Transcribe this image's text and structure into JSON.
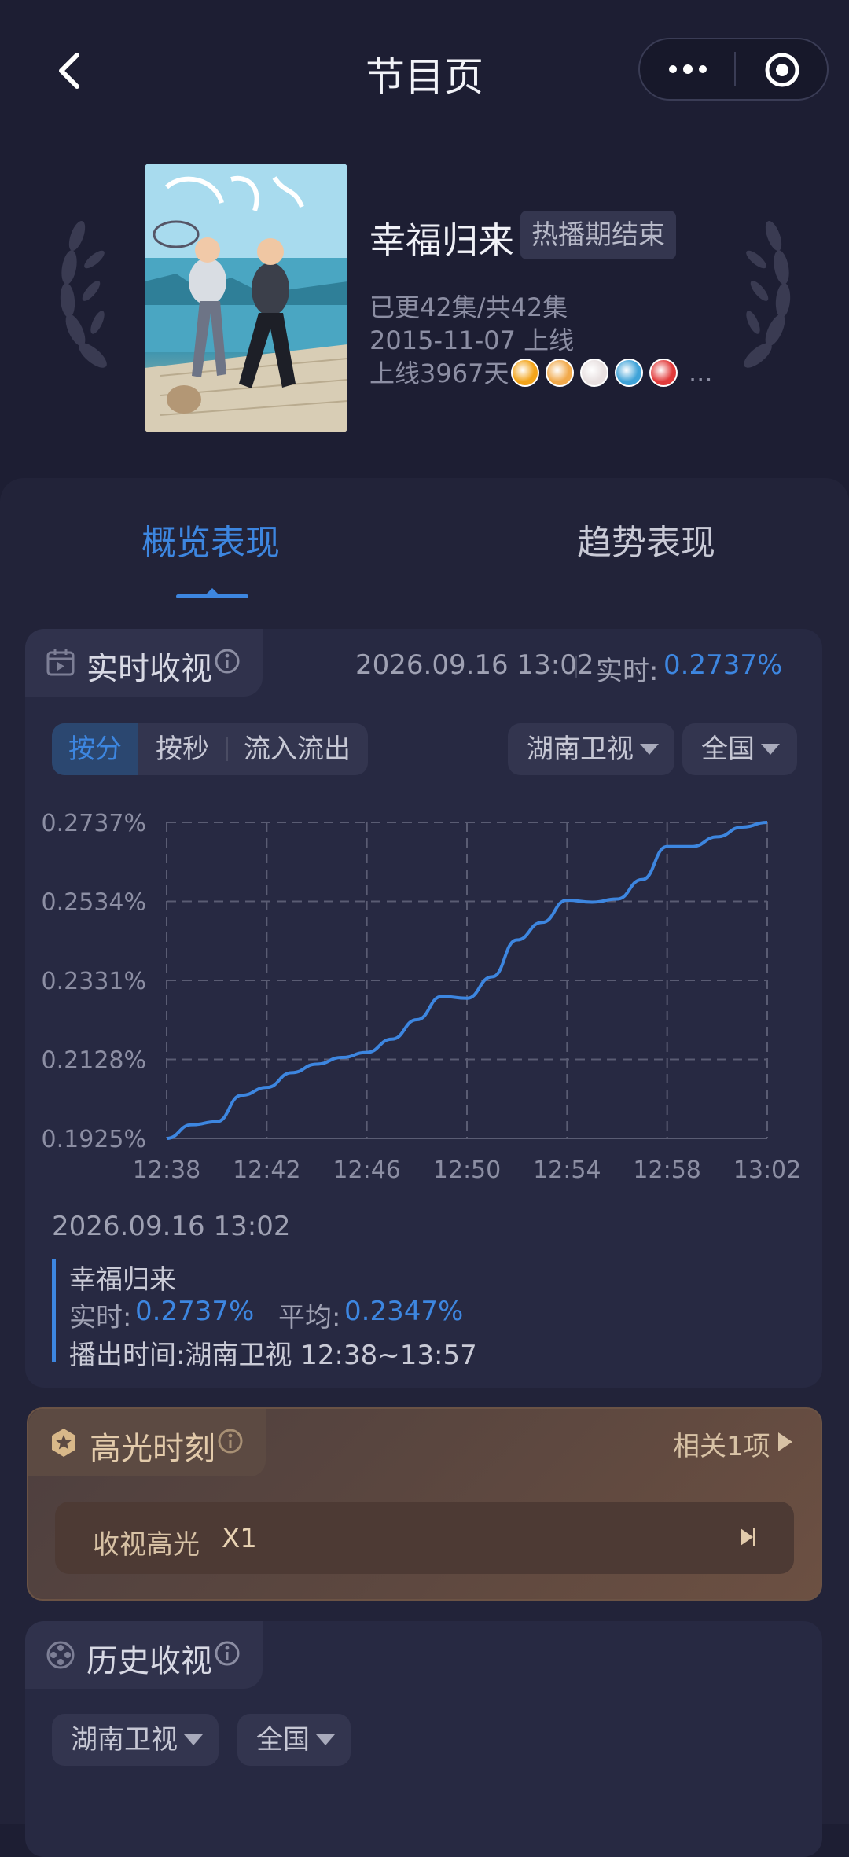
{
  "header": {
    "title": "节目页",
    "back_icon": "chevron-left-icon",
    "more_icon": "more-dots-icon",
    "target_icon": "target-circle-icon"
  },
  "show": {
    "title": "幸福归来",
    "status": "热播期结束",
    "episodes": "已更42集/共42集",
    "premiere": "2015-11-07 上线",
    "days_online": "上线3967天",
    "more": "...",
    "channel_logos": [
      "hunan-tv-logo",
      "shenzhen-tv-logo",
      "jiangsu-tv-logo",
      "zhejiang-tv-logo",
      "dragon-tv-logo"
    ],
    "logo_colors": [
      "#f3a41a",
      "#f1a94a",
      "#e8e0e0",
      "#3fa3d8",
      "#e23b3b"
    ]
  },
  "tabs": [
    {
      "label": "概览表现",
      "active": true
    },
    {
      "label": "趋势表现",
      "active": false
    }
  ],
  "realtime": {
    "title": "实时收视",
    "timestamp": "2026.09.16 13:02",
    "label": "实时:",
    "value": "0.2737%",
    "modes": [
      "按分",
      "按秒",
      "流入流出"
    ],
    "active_mode": "按分",
    "channel": "湖南卫视",
    "region": "全国"
  },
  "chart_data": {
    "type": "line",
    "title": "",
    "xlabel": "",
    "ylabel": "",
    "x_ticks": [
      "12:38",
      "12:42",
      "12:46",
      "12:50",
      "12:54",
      "12:58",
      "13:02"
    ],
    "y_ticks": [
      "0.1925%",
      "0.2128%",
      "0.2331%",
      "0.2534%",
      "0.2737%"
    ],
    "ylim": [
      0.1925,
      0.2737
    ],
    "grid": true,
    "series": [
      {
        "color": "#3d86e0",
        "x": [
          "12:38",
          "12:39",
          "12:40",
          "12:41",
          "12:42",
          "12:43",
          "12:44",
          "12:45",
          "12:46",
          "12:47",
          "12:48",
          "12:49",
          "12:50",
          "12:51",
          "12:52",
          "12:53",
          "12:54",
          "12:55",
          "12:56",
          "12:57",
          "12:58",
          "12:59",
          "13:00",
          "13:01",
          "13:02"
        ],
        "values": [
          0.1925,
          0.196,
          0.1968,
          0.2036,
          0.2056,
          0.2094,
          0.2116,
          0.2133,
          0.2146,
          0.218,
          0.223,
          0.229,
          0.2285,
          0.234,
          0.2435,
          0.248,
          0.2537,
          0.2532,
          0.254,
          0.259,
          0.2675,
          0.2675,
          0.27,
          0.2725,
          0.2737
        ]
      }
    ]
  },
  "detail": {
    "timestamp": "2026.09.16 13:02",
    "show": "幸福归来",
    "realtime_label": "实时:",
    "realtime_value": "0.2737%",
    "average_label": "平均:",
    "average_value": "0.2347%",
    "airtime": "播出时间:湖南卫视 12:38~13:57"
  },
  "highlight": {
    "title": "高光时刻",
    "related": "相关1项",
    "item_label": "收视高光",
    "item_count": "X1"
  },
  "history": {
    "title": "历史收视",
    "channel": "湖南卫视",
    "region": "全国"
  }
}
